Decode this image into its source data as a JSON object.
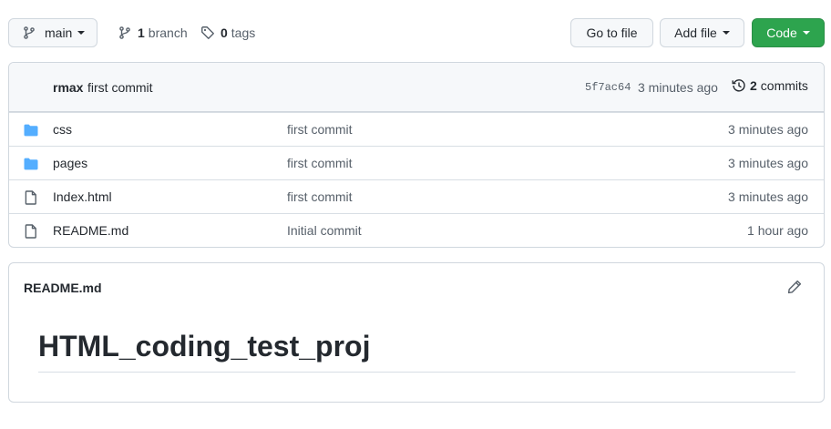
{
  "toolbar": {
    "branch_label": "main",
    "branches_count": "1",
    "branches_text": "branch",
    "tags_count": "0",
    "tags_text": "tags",
    "goto_label": "Go to file",
    "addfile_label": "Add file",
    "code_label": "Code"
  },
  "commit": {
    "author": "rmax",
    "message": "first commit",
    "sha": "5f7ac64",
    "time": "3 minutes ago",
    "count": "2",
    "count_text": "commits"
  },
  "files": [
    {
      "name": "css",
      "type": "folder",
      "message": "first commit",
      "age": "3 minutes ago"
    },
    {
      "name": "pages",
      "type": "folder",
      "message": "first commit",
      "age": "3 minutes ago"
    },
    {
      "name": "Index.html",
      "type": "file",
      "message": "first commit",
      "age": "3 minutes ago"
    },
    {
      "name": "README.md",
      "type": "file",
      "message": "Initial commit",
      "age": "1 hour ago"
    }
  ],
  "readme": {
    "title": "README.md",
    "heading": "HTML_coding_test_proj"
  },
  "colors": {
    "code_button": "#2da44e",
    "folder_icon": "#54aeff",
    "file_icon": "#57606a"
  },
  "icons": {
    "branch": "git-branch-icon",
    "tag": "tag-icon",
    "history": "history-icon",
    "folder": "folder-icon",
    "file": "file-icon",
    "edit": "pencil-icon"
  }
}
